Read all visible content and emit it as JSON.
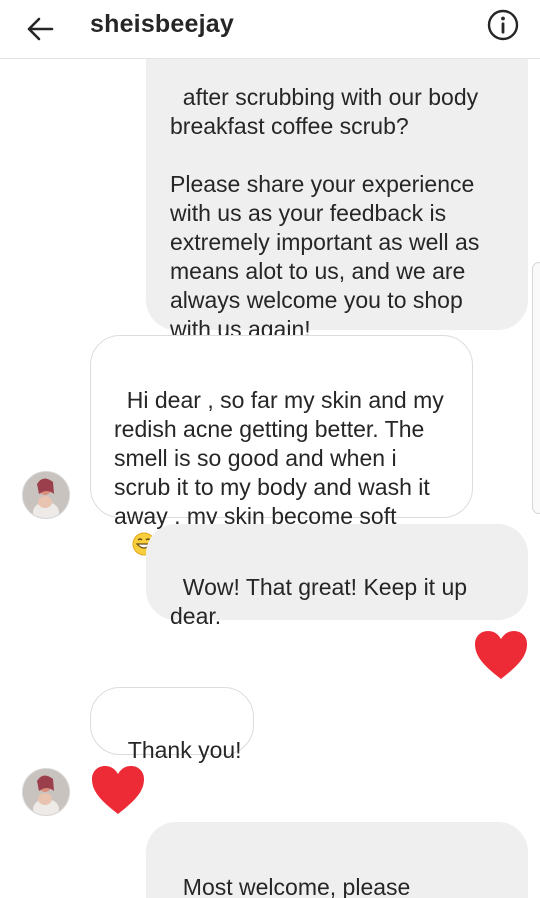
{
  "header": {
    "username": "sheisbeejay",
    "back_icon": "arrow-left-icon",
    "info_icon": "info-circle-icon"
  },
  "messages": [
    {
      "from": "me",
      "text": "after scrubbing with our body\nbreakfast coffee scrub?\n\nPlease share your experience\nwith us as your feedback is\nextremely important as well as\nmeans alot to us, and we are\nalways welcome you to shop\nwith us again!"
    },
    {
      "from": "them",
      "text": "Hi dear , so far my skin and my\nredish acne getting better. The\nsmell is so good and when i\nscrub it to my body and wash it\naway , my skin become soft",
      "emoji": "grinning-face-emoji"
    },
    {
      "from": "me",
      "text": "Wow! That great! Keep it up\ndear."
    },
    {
      "from": "me",
      "reaction": "heart-icon"
    },
    {
      "from": "them",
      "text": "Thank you!"
    },
    {
      "from": "them",
      "reaction": "heart-icon"
    },
    {
      "from": "me",
      "text": "Most welcome, please\nrecommend to your circle if you"
    }
  ],
  "colors": {
    "sent_bubble": "#efefef",
    "received_border": "#dcdcdc",
    "heart": "#ed2b37",
    "text": "#262626"
  }
}
